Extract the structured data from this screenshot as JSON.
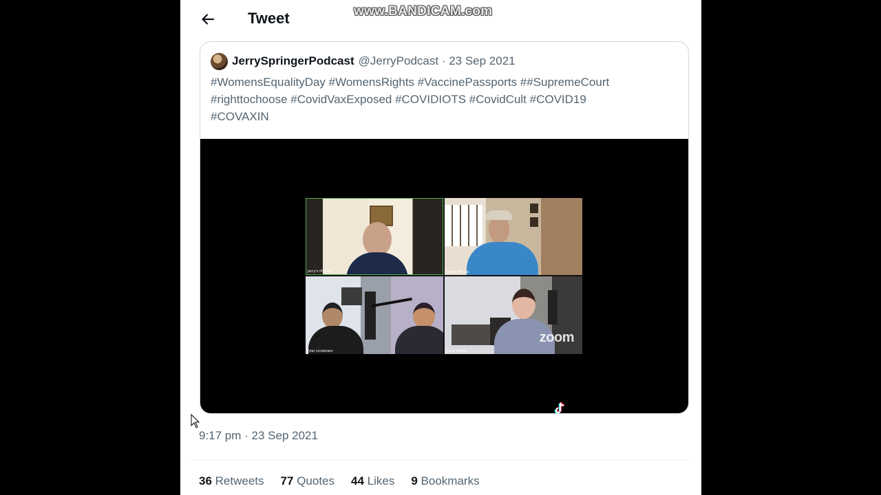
{
  "watermark": "www.BANDICAM.com",
  "header": {
    "title": "Tweet",
    "back_icon": "arrow-left-icon"
  },
  "quote": {
    "author_name": "JerryspringerPodcast",
    "author_display": "JerrySpringerPodcast",
    "handle_date": "@JerryPodcast · 23 Sep 2021",
    "text_lines": [
      "#WomensEqualityDay #WomensRights #VaccinePassports ##SupremeCourt",
      "#righttochoose #CovidVaxExposed #COVIDIOTS #CovidCult #COVID19",
      "#COVAXIN"
    ]
  },
  "media": {
    "tiles": [
      {
        "label": "Jerry's iPhone"
      },
      {
        "label": "Jene's iPhone"
      },
      {
        "label": "Tyler Lindsham"
      },
      {
        "label": "Frank Broski"
      }
    ],
    "zoom_logo": "zoom",
    "overlay_icon": "tiktok-icon"
  },
  "timestamp": "9:17 pm · 23 Sep 2021",
  "stats": [
    {
      "num": "36",
      "label": "Retweets"
    },
    {
      "num": "77",
      "label": "Quotes"
    },
    {
      "num": "44",
      "label": "Likes"
    },
    {
      "num": "9",
      "label": "Bookmarks"
    }
  ],
  "colors": {
    "text_primary": "#0f1419",
    "text_secondary": "#536471",
    "border": "#cfd9de",
    "background_outer": "#000000"
  }
}
